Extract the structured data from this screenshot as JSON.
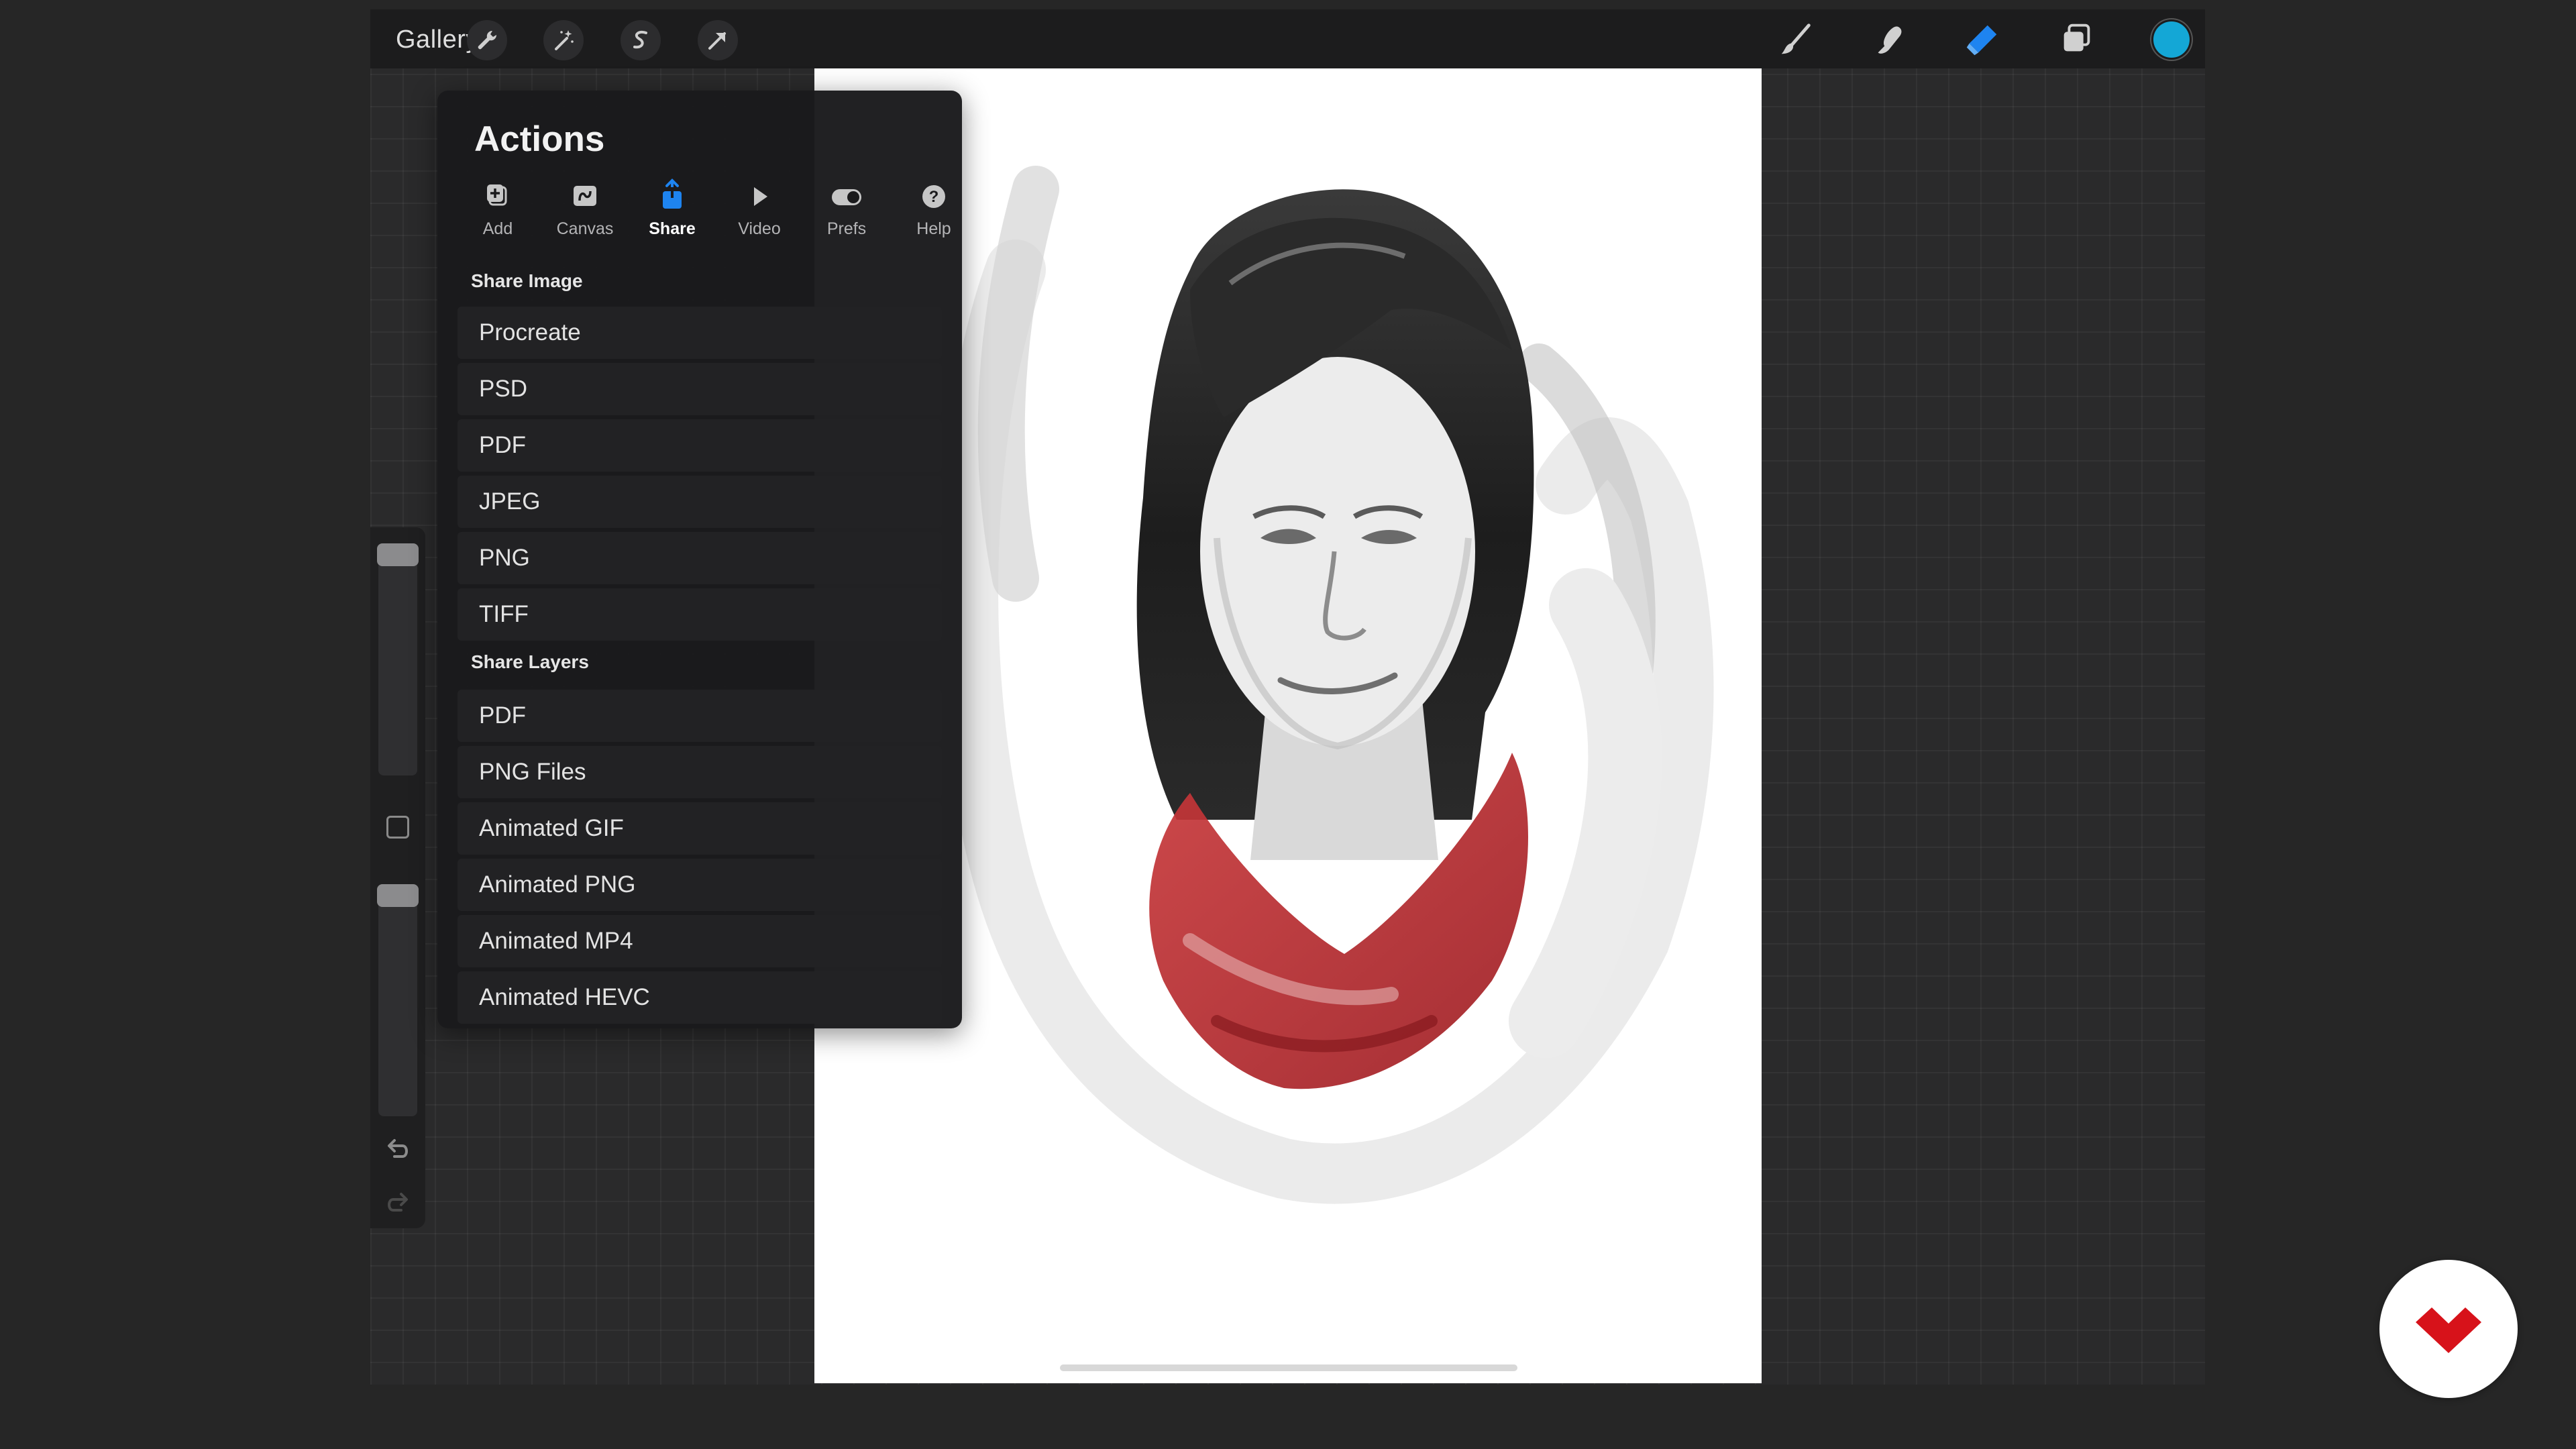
{
  "topbar": {
    "gallery_label": "Gallery",
    "left_tools": [
      "wrench-icon",
      "magic-wand-icon",
      "selection-icon",
      "transform-arrow-icon"
    ],
    "right_tools": [
      "brush-icon",
      "smudge-icon",
      "eraser-icon",
      "layers-icon"
    ],
    "active_tool": "eraser",
    "current_color": "#14a7d6"
  },
  "actions": {
    "title": "Actions",
    "tabs": [
      {
        "label": "Add",
        "icon": "add-icon"
      },
      {
        "label": "Canvas",
        "icon": "canvas-icon"
      },
      {
        "label": "Share",
        "icon": "share-icon",
        "active": true
      },
      {
        "label": "Video",
        "icon": "play-icon"
      },
      {
        "label": "Prefs",
        "icon": "toggle-icon"
      },
      {
        "label": "Help",
        "icon": "help-icon"
      }
    ],
    "share_image": {
      "heading": "Share Image",
      "items": [
        "Procreate",
        "PSD",
        "PDF",
        "JPEG",
        "PNG",
        "TIFF"
      ]
    },
    "share_layers": {
      "heading": "Share Layers",
      "items": [
        "PDF",
        "PNG Files",
        "Animated GIF",
        "Animated PNG",
        "Animated MP4",
        "Animated HEVC"
      ]
    }
  },
  "sidebar": {
    "brush_size_level": 0.03,
    "opacity_level": 0.03,
    "icons": [
      "modify-button",
      "undo-arrow-icon",
      "redo-arrow-icon"
    ]
  },
  "colors": {
    "accent_blue": "#1e84f0",
    "color_well": "#14a7d6",
    "logo_red": "#d7121a"
  }
}
